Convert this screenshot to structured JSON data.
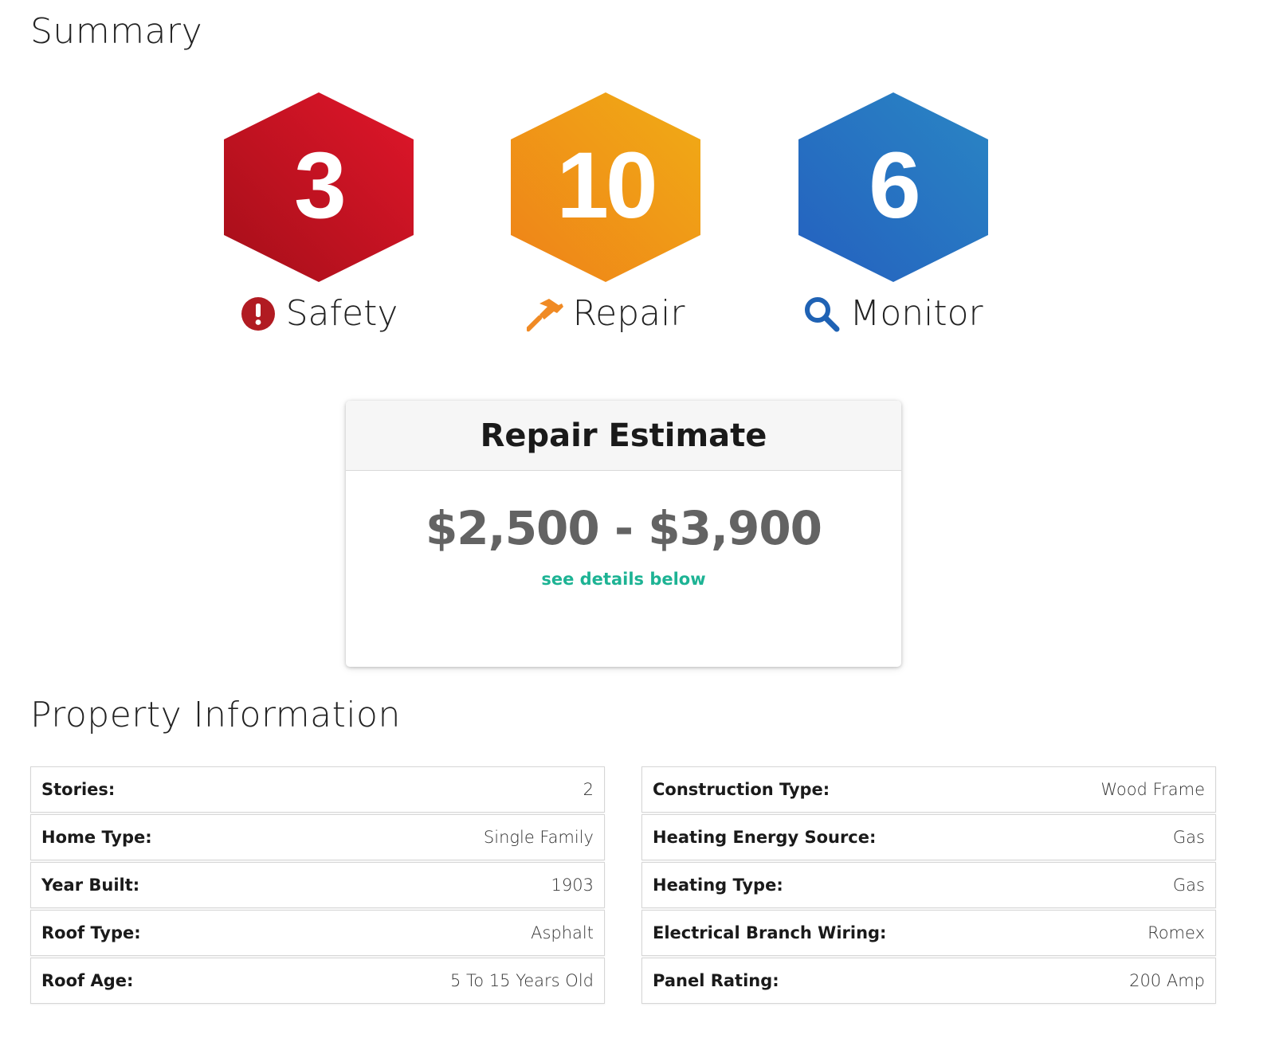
{
  "summary": {
    "title": "Summary",
    "badges": [
      {
        "count": "3",
        "label": "Safety",
        "icon": "exclamation-circle-icon",
        "color": "#c8121e"
      },
      {
        "count": "10",
        "label": "Repair",
        "icon": "hammer-icon",
        "color": "#f09a14"
      },
      {
        "count": "6",
        "label": "Monitor",
        "icon": "magnifier-icon",
        "color": "#2470c0"
      }
    ]
  },
  "estimate": {
    "title": "Repair Estimate",
    "range": "$2,500 - $3,900",
    "link": "see details below",
    "link_color": "#1db394"
  },
  "property": {
    "title": "Property Information",
    "left": [
      {
        "label": "Stories:",
        "value": "2"
      },
      {
        "label": "Home Type:",
        "value": "Single Family"
      },
      {
        "label": "Year Built:",
        "value": "1903"
      },
      {
        "label": "Roof Type:",
        "value": "Asphalt"
      },
      {
        "label": "Roof Age:",
        "value": "5 To 15 Years Old"
      }
    ],
    "right": [
      {
        "label": "Construction Type:",
        "value": "Wood Frame"
      },
      {
        "label": "Heating Energy Source:",
        "value": "Gas"
      },
      {
        "label": "Heating Type:",
        "value": "Gas"
      },
      {
        "label": "Electrical Branch Wiring:",
        "value": "Romex"
      },
      {
        "label": "Panel Rating:",
        "value": "200 Amp"
      }
    ]
  }
}
